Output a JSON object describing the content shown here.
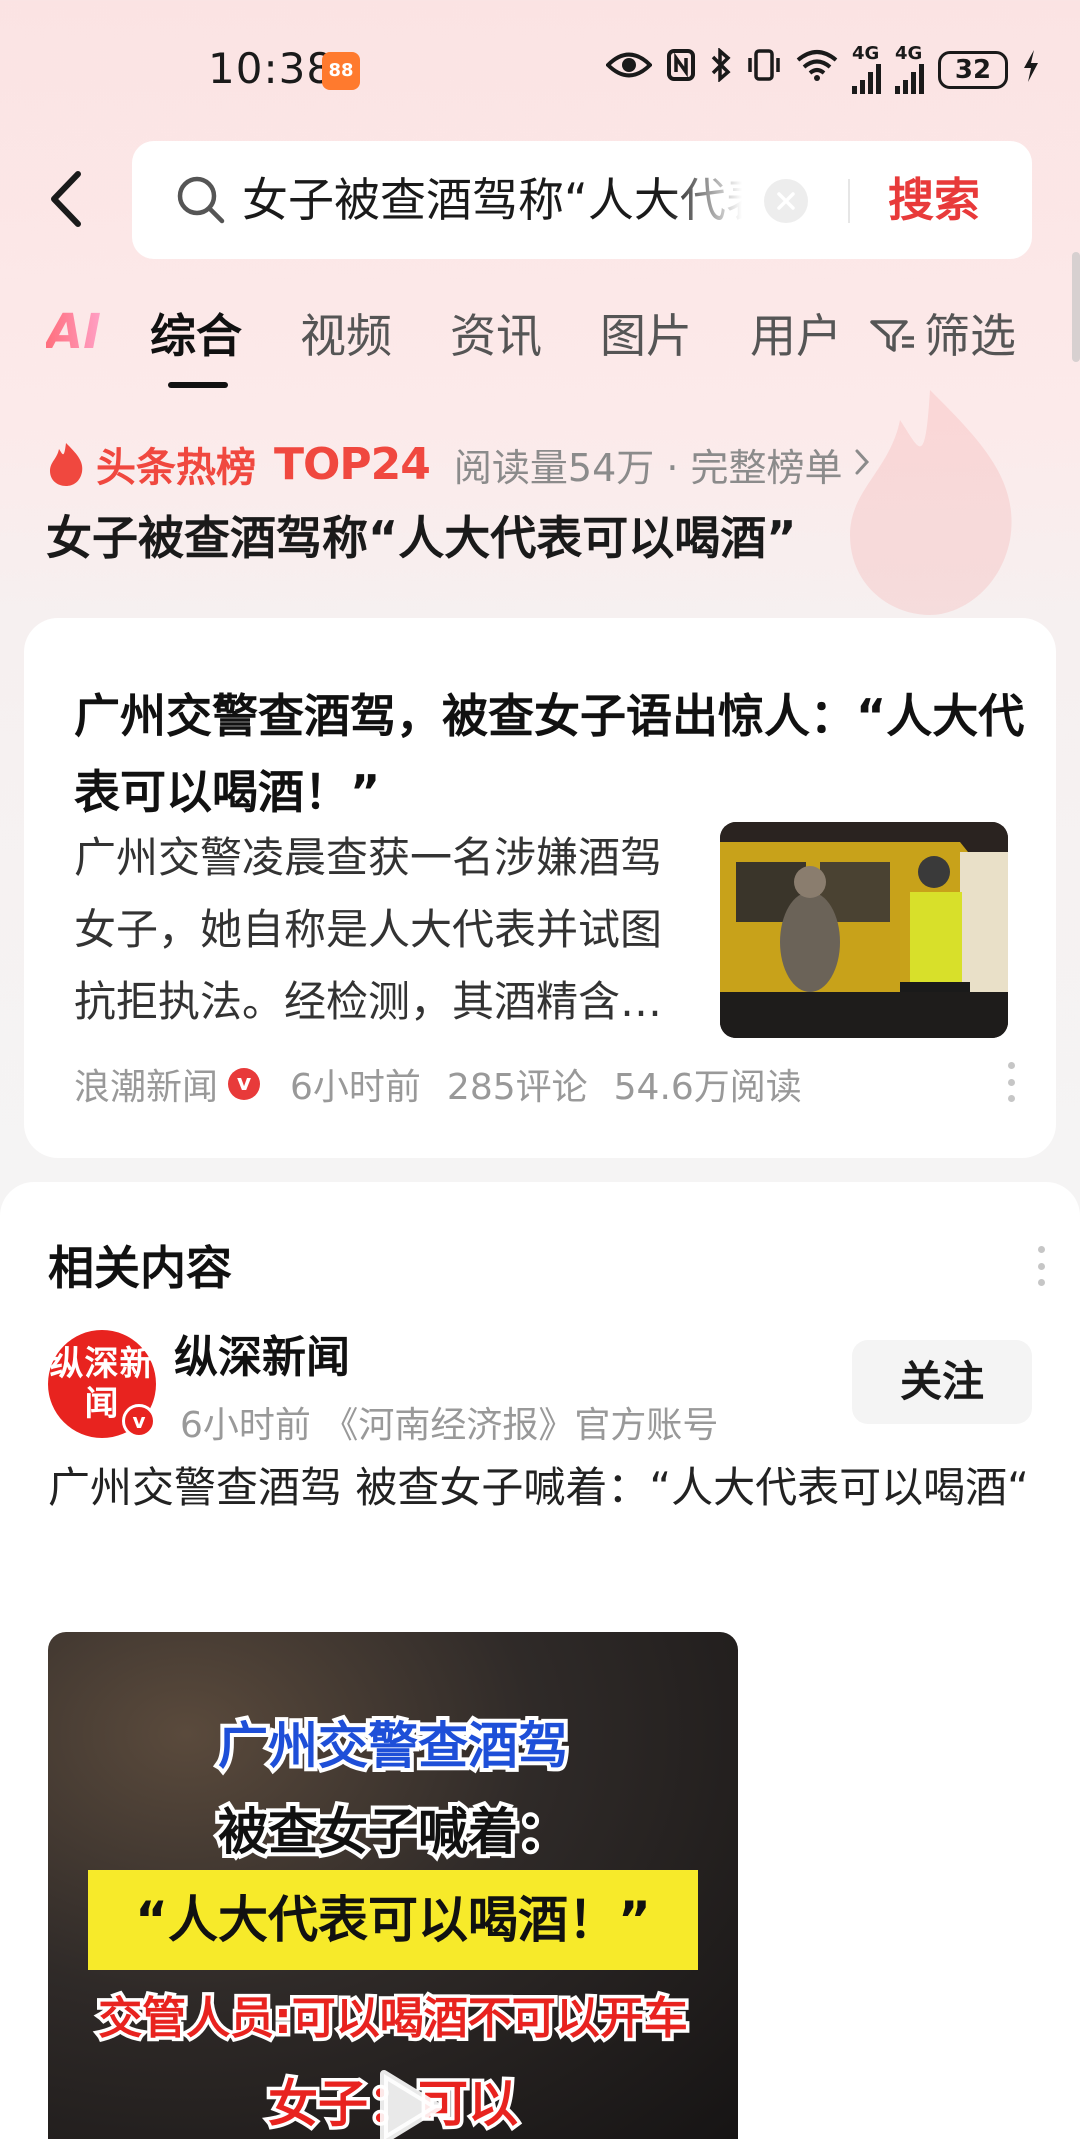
{
  "status_bar": {
    "time": "10:38",
    "app_icon_text": "88",
    "network_label_1": "4G",
    "network_label_2": "4G",
    "battery": "32"
  },
  "search": {
    "query": "女子被查酒驾称“人大代表可以喝酒”",
    "submit_label": "搜索"
  },
  "tabs": {
    "ai": "AI",
    "items": [
      "综合",
      "视频",
      "资讯",
      "图片",
      "用户"
    ],
    "active_index": 0,
    "filter": "筛选"
  },
  "hot_rank": {
    "label": "头条热榜",
    "rank": "TOP24",
    "meta": "阅读量54万 · 完整榜单",
    "title": "女子被查酒驾称“人大代表可以喝酒”"
  },
  "news_card": {
    "title": "广州交警查酒驾，被查女子语出惊人：“人大代表可以喝酒！”",
    "summary": "广州交警凌晨查获一名涉嫌酒驾女子，她自称是人大代表并试图抗拒执法。经检测，其酒精含量超标，依法处理。",
    "source": "浪潮新闻",
    "verified": "v",
    "time": "6小时前",
    "comments": "285评论",
    "reads": "54.6万阅读"
  },
  "related": {
    "heading": "相关内容",
    "author": {
      "avatar_text": "纵深新闻",
      "badge": "v",
      "name": "纵深新闻",
      "meta": "6小时前  《河南经济报》官方账号"
    },
    "follow_label": "关注",
    "post_text": "广州交警查酒驾 被查女子喊着：“人大代表可以喝酒“",
    "video": {
      "line1": "广州交警查酒驾",
      "line2": "被查女子喊着：",
      "line3": "“人大代表可以喝酒！”",
      "line4": "交管人员:可以喝酒不可以开车",
      "line5": "女子：可以"
    }
  },
  "colors": {
    "accent": "#e83a3a",
    "hot_rank": "#f0483f",
    "caption_blue": "#1e4fd8",
    "caption_yellow": "#f7ea2a"
  },
  "icons": [
    "back-icon",
    "search-icon",
    "clear-icon",
    "filter-icon",
    "flame-icon",
    "more-icon",
    "play-icon",
    "eye-icon",
    "nfc-icon",
    "bluetooth-icon",
    "vibrate-icon",
    "wifi-icon",
    "charging-icon"
  ]
}
